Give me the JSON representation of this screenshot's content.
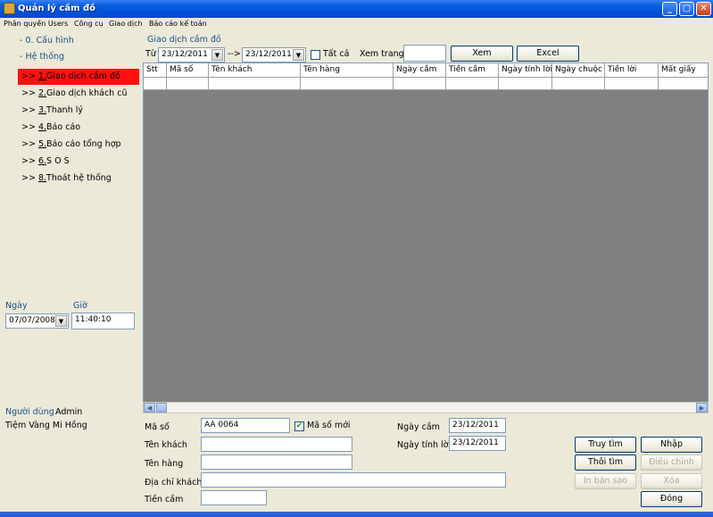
{
  "window": {
    "title": "Quản lý cầm đồ",
    "controls": {
      "minimize": "_",
      "maximize": "▢",
      "close": "✕"
    }
  },
  "menu": [
    "Phân quyền Users",
    "Công cụ",
    "Giao dịch",
    "Báo cáo kế toán"
  ],
  "sidebar": {
    "config": "- 0. Cấu hình",
    "system": "- Hệ thống",
    "items": [
      {
        "prefix": ">> ",
        "num": "1.",
        "label": "Giao dịch cầm đồ"
      },
      {
        "prefix": ">> ",
        "num": "2.",
        "label": "Giao dịch khách cũ"
      },
      {
        "prefix": ">> ",
        "num": "3.",
        "label": "Thanh lý"
      },
      {
        "prefix": ">> ",
        "num": "4.",
        "label": "Báo cáo"
      },
      {
        "prefix": ">> ",
        "num": "5.",
        "label": "Báo cáo tổng hợp"
      },
      {
        "prefix": ">> ",
        "num": "6.",
        "label": "S O S"
      },
      {
        "prefix": ">> ",
        "num": "8.",
        "label": "Thoát hệ thống"
      }
    ],
    "date_label": "Ngày",
    "time_label": "Giờ",
    "date_value": "07/07/2008",
    "time_value": "11:40:10",
    "user_label": "Người dùng",
    "user_name": "Admin",
    "shop_name": "Tiệm Vàng Mi Hồng"
  },
  "filter": {
    "group_title": "Giao dịch cầm đồ",
    "from_label": "Từ",
    "from_date": "23/12/2011",
    "arrow": "-->",
    "to_date": "23/12/2011",
    "all_label": "Tất cả",
    "page_label": "Xem trang",
    "page_value": "",
    "view_button": "Xem",
    "excel_button": "Excel"
  },
  "grid": {
    "columns": [
      "Stt",
      "Mã số",
      "Tên khách",
      "Tên hàng",
      "Ngày cầm",
      "Tiền cầm",
      "Ngày tính lời",
      "Ngày chuộc",
      "Tiền lời",
      "Mất giấy"
    ],
    "rows": []
  },
  "form": {
    "code_label": "Mã số",
    "code_value": "AA 0064",
    "new_code_label": "Mã số mới",
    "new_code_checked": true,
    "pawn_date_label": "Ngày cầm",
    "pawn_date_value": "23/12/2011",
    "interest_date_label": "Ngày tính lời",
    "interest_date_value": "23/12/2011",
    "customer_label": "Tên khách",
    "customer_value": "",
    "goods_label": "Tên hàng",
    "goods_value": "",
    "address_label": "Địa chỉ khách",
    "address_value": "",
    "amount_label": "Tiền cầm",
    "amount_value": ""
  },
  "actions": {
    "search": "Truy tìm",
    "stop_search": "Thôi tìm",
    "print_copy": "In bản sao",
    "input": "Nhập",
    "adjust": "Điều chỉnh",
    "delete": "Xóa",
    "close": "Đóng"
  }
}
